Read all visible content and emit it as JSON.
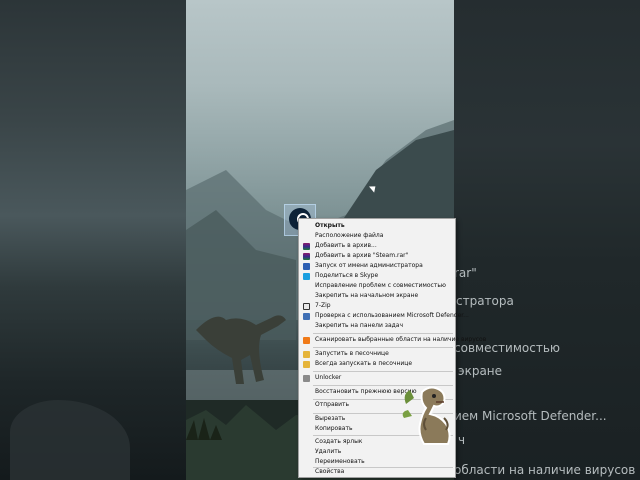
{
  "context_menu": {
    "items": [
      {
        "label": "Открыть",
        "icon": "",
        "bold": true
      },
      {
        "label": "Расположение файла",
        "icon": ""
      },
      {
        "label": "Добавить в архив...",
        "icon": "winrar-icon"
      },
      {
        "label": "Добавить в архив \"Steam.rar\"",
        "icon": "winrar-icon"
      },
      {
        "label": "Запуск от имени администратора",
        "icon": "shield-icon"
      },
      {
        "label": "Поделиться в Skype",
        "icon": "skype-icon"
      },
      {
        "label": "Исправление проблем с совместимостью",
        "icon": ""
      },
      {
        "label": "Закрепить на начальном экране",
        "icon": ""
      },
      {
        "label": "7-Zip",
        "icon": "7zip-icon"
      },
      {
        "label": "Проверка с использованием Microsoft Defender...",
        "icon": "defender-icon"
      },
      {
        "label": "Закрепить на панели задач",
        "icon": ""
      },
      {
        "label": "Сканировать выбранные области на наличие вирусов",
        "icon": "avast-icon"
      },
      {
        "label": "Запустить в песочнице",
        "icon": "sandbox-icon"
      },
      {
        "label": "Всегда запускать в песочнице",
        "icon": "sandbox-icon"
      },
      {
        "label": "Unlocker",
        "icon": "unlocker-icon"
      },
      {
        "label": "Восстановить прежнюю версию",
        "icon": ""
      },
      {
        "label": "Отправить",
        "icon": ""
      },
      {
        "label": "Вырезать",
        "icon": ""
      },
      {
        "label": "Копировать",
        "icon": ""
      },
      {
        "label": "Создать ярлык",
        "icon": ""
      },
      {
        "label": "Удалить",
        "icon": ""
      },
      {
        "label": "Переименовать",
        "icon": ""
      },
      {
        "label": "Свойства",
        "icon": ""
      }
    ]
  },
  "desktop_icon": {
    "label": "Steam",
    "icon": "steam-icon"
  },
  "blurred_right_texts": [
    "rar\"",
    "стратора",
    "совместимостью",
    "экране",
    "ием Microsoft Defender...",
    "ч",
    "области на наличие вирусов"
  ],
  "colors": {
    "menu_bg": "#f2f2f2",
    "menu_border": "#a0a0a0",
    "accent": "#2d5fb3"
  }
}
